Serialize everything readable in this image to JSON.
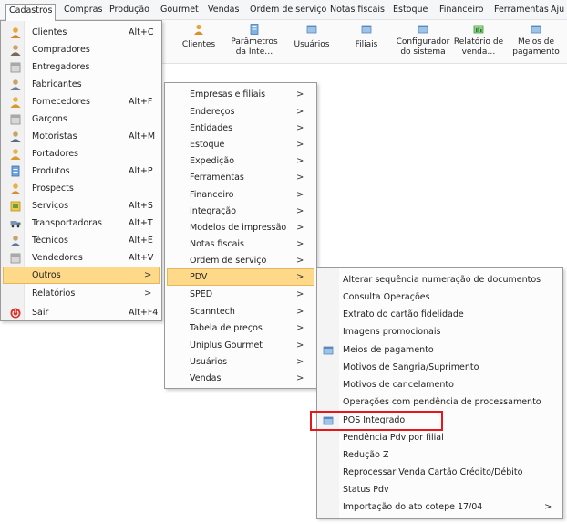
{
  "menubar": {
    "items": [
      {
        "label": "Cadastros"
      },
      {
        "label": "Compras"
      },
      {
        "label": "Produção"
      },
      {
        "label": "Gourmet"
      },
      {
        "label": "Vendas"
      },
      {
        "label": "Ordem de serviço"
      },
      {
        "label": "Notas fiscais"
      },
      {
        "label": "Estoque"
      },
      {
        "label": "Financeiro"
      },
      {
        "label": "Ferramentas"
      },
      {
        "label": "Aju"
      }
    ]
  },
  "toolbar": {
    "buttons": [
      {
        "label": "Clientes"
      },
      {
        "label": "Parâmetros\nda Inte…"
      },
      {
        "label": "Usuários"
      },
      {
        "label": "Filiais"
      },
      {
        "label": "Configurador\ndo sistema"
      },
      {
        "label": "Relatório de\nvenda…"
      },
      {
        "label": "Meios de\npagamento"
      }
    ]
  },
  "cadastros_menu": {
    "items": [
      {
        "label": "Clientes",
        "shortcut": "Alt+C",
        "icon": "person-icon"
      },
      {
        "label": "Compradores",
        "shortcut": "",
        "icon": "person-icon"
      },
      {
        "label": "Entregadores",
        "shortcut": "",
        "icon": "box-icon"
      },
      {
        "label": "Fabricantes",
        "shortcut": "",
        "icon": "person-icon"
      },
      {
        "label": "Fornecedores",
        "shortcut": "Alt+F",
        "icon": "person-icon"
      },
      {
        "label": "Garçons",
        "shortcut": "",
        "icon": "box-icon"
      },
      {
        "label": "Motoristas",
        "shortcut": "Alt+M",
        "icon": "person-icon"
      },
      {
        "label": "Portadores",
        "shortcut": "",
        "icon": "person-icon"
      },
      {
        "label": "Produtos",
        "shortcut": "Alt+P",
        "icon": "product-icon"
      },
      {
        "label": "Prospects",
        "shortcut": "",
        "icon": "person-icon"
      },
      {
        "label": "Serviços",
        "shortcut": "Alt+S",
        "icon": "service-icon"
      },
      {
        "label": "Transportadoras",
        "shortcut": "Alt+T",
        "icon": "truck-icon"
      },
      {
        "label": "Técnicos",
        "shortcut": "Alt+E",
        "icon": "person-icon"
      },
      {
        "label": "Vendedores",
        "shortcut": "Alt+V",
        "icon": "box-icon"
      },
      {
        "label": "Outros",
        "shortcut": "",
        "submenu": true
      },
      {
        "label": "Relatórios",
        "shortcut": "",
        "submenu": true
      },
      {
        "label": "Sair",
        "shortcut": "Alt+F4",
        "icon": "power-icon"
      }
    ]
  },
  "outros_menu": {
    "items": [
      {
        "label": "Empresas e filiais"
      },
      {
        "label": "Endereços"
      },
      {
        "label": "Entidades"
      },
      {
        "label": "Estoque"
      },
      {
        "label": "Expedição"
      },
      {
        "label": "Ferramentas"
      },
      {
        "label": "Financeiro"
      },
      {
        "label": "Integração"
      },
      {
        "label": "Modelos de impressão"
      },
      {
        "label": "Notas fiscais"
      },
      {
        "label": "Ordem de serviço"
      },
      {
        "label": "PDV"
      },
      {
        "label": "SPED"
      },
      {
        "label": "Scanntech"
      },
      {
        "label": "Tabela de preços"
      },
      {
        "label": "Uniplus Gourmet"
      },
      {
        "label": "Usuários"
      },
      {
        "label": "Vendas"
      }
    ]
  },
  "pdv_menu": {
    "items": [
      {
        "label": "Alterar sequência numeração de documentos"
      },
      {
        "label": "Consulta Operações"
      },
      {
        "label": "Extrato do cartão fidelidade"
      },
      {
        "label": "Imagens promocionais"
      },
      {
        "label": "Meios de pagamento",
        "icon": true
      },
      {
        "label": "Motivos de Sangria/Suprimento"
      },
      {
        "label": "Motivos de cancelamento"
      },
      {
        "label": "Operações com pendência de processamento"
      },
      {
        "label": "POS Integrado",
        "icon": true
      },
      {
        "label": "Pendência Pdv por filial"
      },
      {
        "label": "Redução Z"
      },
      {
        "label": "Reprocessar Venda Cartão Crédito/Débito"
      },
      {
        "label": "Status Pdv"
      },
      {
        "label": "Importação do ato cotepe 17/04",
        "submenu": true
      }
    ]
  },
  "colors": {
    "selection": "#ffd98a",
    "highlight": "#e8161b"
  }
}
